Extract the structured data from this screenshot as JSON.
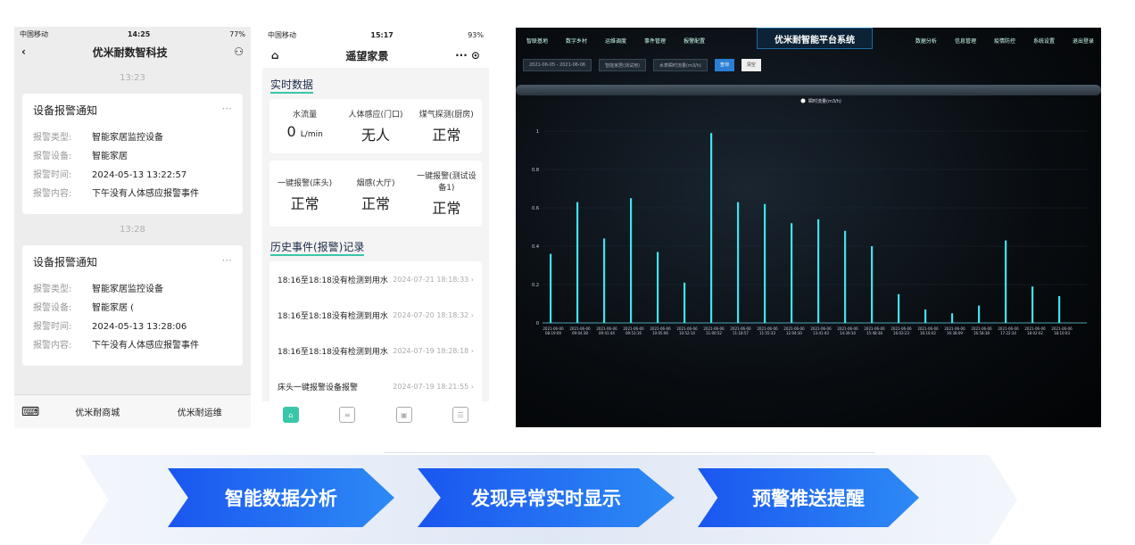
{
  "wechat": {
    "status": {
      "carrier": "中国移动",
      "time": "14:25",
      "battery": "77%"
    },
    "title": "优米耐数智科技",
    "messages": [
      {
        "time": "13:23",
        "title": "设备报警通知",
        "rows": [
          {
            "k": "报警类型:",
            "v": "智能家居监控设备"
          },
          {
            "k": "报警设备:",
            "v": "智能家居"
          },
          {
            "k": "报警时间:",
            "v": "2024-05-13 13:22:57"
          },
          {
            "k": "报警内容:",
            "v": "下午没有人体感应报警事件"
          }
        ]
      },
      {
        "time": "13:28",
        "title": "设备报警通知",
        "rows": [
          {
            "k": "报警类型:",
            "v": "智能家居监控设备"
          },
          {
            "k": "报警设备:",
            "v": "智能家居 ("
          },
          {
            "k": "报警时间:",
            "v": "2024-05-13 13:28:06"
          },
          {
            "k": "报警内容:",
            "v": "下午没有人体感应报警事件"
          }
        ]
      }
    ],
    "menu": [
      "优米耐商城",
      "优米耐运维"
    ]
  },
  "mini": {
    "status": {
      "carrier": "中国移动",
      "time": "15:17",
      "battery": "93%"
    },
    "title": "遥望家景",
    "realtime_title": "实时数据",
    "row1": [
      {
        "label": "水流量",
        "value": "0",
        "unit": "L/min"
      },
      {
        "label": "人体感应(门口)",
        "value": "无人",
        "unit": ""
      },
      {
        "label": "煤气探测(厨房)",
        "value": "正常",
        "unit": ""
      }
    ],
    "row2": [
      {
        "label": "一键报警(床头)",
        "value": "正常"
      },
      {
        "label": "烟感(大厅)",
        "value": "正常"
      },
      {
        "label": "一键报警(测试设备1)",
        "value": "正常"
      }
    ],
    "history_title": "历史事件(报警)记录",
    "history": [
      {
        "text": "18:16至18:18没有检测到用水",
        "date": "2024-07-21 18:18:33"
      },
      {
        "text": "18:16至18:18没有检测到用水",
        "date": "2024-07-20 18:18:32"
      },
      {
        "text": "18:16至18:18没有检测到用水",
        "date": "2024-07-19 18:28:18"
      },
      {
        "text": "床头一键报警设备报警",
        "date": "2024-07-19 18:21:55"
      }
    ]
  },
  "dash": {
    "title": "优米耐智能平台系统",
    "nav_left": [
      "智联基地",
      "数字乡村",
      "运维调度",
      "事件管理",
      "报警配置"
    ],
    "nav_right": [
      "数据分析",
      "信息管理",
      "疫情防控",
      "系统设置",
      "退出登录"
    ],
    "filters": [
      "2021-06-05 - 2021-06-06",
      "智能家居(测试用)",
      "水表瞬时流量(m3/h)"
    ],
    "query_btn": "查询",
    "reset_btn": "清空"
  },
  "chart_data": {
    "type": "bar",
    "title": "",
    "legend": "瞬时流量(m3/h)",
    "ylim": [
      0,
      1
    ],
    "yticks": [
      "0",
      "0.2",
      "0.4",
      "0.6",
      "0.8",
      "1"
    ],
    "categories": [
      "2021-06-06 08:19:09",
      "2021-06-06 09:04:38",
      "2021-06-06 09:41:44",
      "2021-06-06 09:53:16",
      "2021-06-06 10:05:06",
      "2021-06-06 10:52:14",
      "2021-06-06 11:00:52",
      "2021-06-06 11:18:57",
      "2021-06-06 11:55:33",
      "2021-06-06 12:04:30",
      "2021-06-06 13:41:43",
      "2021-06-06 14:39:34",
      "2021-06-06 15:48:38",
      "2021-06-06 16:03:23",
      "2021-06-06 16:16:02",
      "2021-06-06 16:38:09",
      "2021-06-06 16:58:38",
      "2021-06-06 17:22:34",
      "2021-06-06 18:02:02",
      "2021-06-06 18:10:03"
    ],
    "values": [
      0.36,
      0.63,
      0.44,
      0.65,
      0.37,
      0.21,
      0.99,
      0.63,
      0.62,
      0.52,
      0.54,
      0.48,
      0.4,
      0.15,
      0.07,
      0.05,
      0.09,
      0.43,
      0.19,
      0.14
    ]
  },
  "banner": {
    "steps": [
      "智能数据分析",
      "发现异常实时显示",
      "预警推送提醒"
    ]
  }
}
